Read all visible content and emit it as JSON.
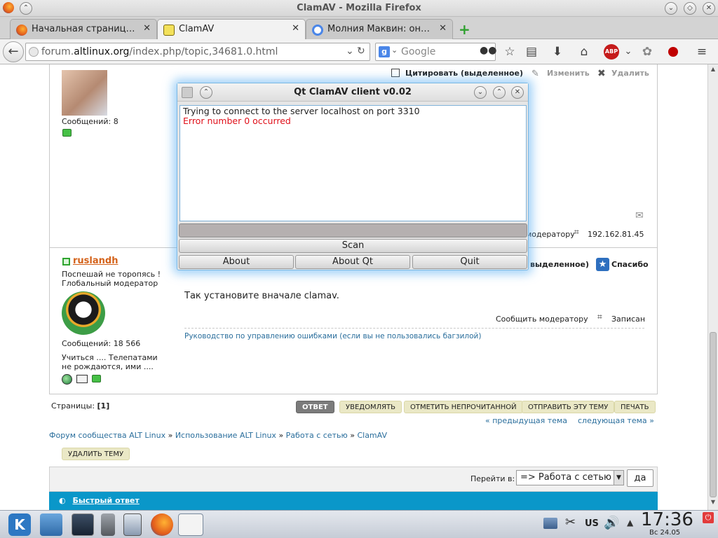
{
  "window": {
    "title": "ClamAV - Mozilla Firefox"
  },
  "tabs": [
    {
      "label": "Начальная страниц…",
      "active": false
    },
    {
      "label": "ClamAV",
      "active": true
    },
    {
      "label": "Молния Маквин: он…",
      "active": false
    }
  ],
  "url": {
    "prefix": "forum.",
    "domain": "altlinux.org",
    "path": "/index.php/topic,34681.0.html"
  },
  "search": {
    "placeholder": "Google"
  },
  "post1": {
    "quote_label": "Цитировать (выделенное)",
    "edit_label": "Изменить",
    "delete_label": "Удалить",
    "messages": "Сообщений: 8",
    "moderator_link": "модератору",
    "ip": "192.162.81.45"
  },
  "post2": {
    "username": "ruslandh",
    "motto": "Поспешай не торопясь !",
    "rank": "Глобальный модератор",
    "messages": "Сообщений: 18 566",
    "signature_line1": "Учиться .... Телепатами",
    "signature_line2": "не рождаются, ими ....",
    "quote_suffix": "выделенное)",
    "thanks_label": "Спасибо",
    "body": "Так установите вначале clamav.",
    "report_label": "Сообщить модератору",
    "logged_label": "Записан",
    "guide_link": "Руководство по управлению ошибками (если вы не пользовались багзилой)"
  },
  "pagination": {
    "label": "Страницы:",
    "current": "[1]"
  },
  "actions": {
    "reply": "ОТВЕТ",
    "notify": "УВЕДОМЛЯТЬ",
    "mark_unread": "ОТМЕТИТЬ НЕПРОЧИТАННОЙ",
    "send_topic": "ОТПРАВИТЬ ЭТУ ТЕМУ",
    "print": "ПЕЧАТЬ",
    "delete_topic": "УДАЛИТЬ ТЕМУ"
  },
  "topic_nav": {
    "prev": "« предыдущая тема",
    "next": "следующая тема »"
  },
  "breadcrumbs": [
    "Форум сообщества ALT Linux",
    "Использование ALT Linux",
    "Работа с сетью",
    "ClamAV"
  ],
  "jump": {
    "label": "Перейти в:",
    "selected": "=> Работа с сетью",
    "go": "да"
  },
  "quick_reply": {
    "label": "Быстрый ответ"
  },
  "dialog": {
    "title": "Qt ClamAV client v0.02",
    "log_line1": "Trying to connect to the server localhost on port 3310",
    "log_line2": "Error number 0 occurred",
    "scan": "Scan",
    "about": "About",
    "about_qt": "About Qt",
    "quit": "Quit",
    "error_color": "#e0101a"
  },
  "taskbar": {
    "keyboard_layout": "US",
    "time": "17:36",
    "date": "Вс 24.05"
  },
  "colors": {
    "accent_link": "#2a6e9c",
    "username": "#d4621a",
    "quick_reply_bar": "#0a97c9"
  }
}
